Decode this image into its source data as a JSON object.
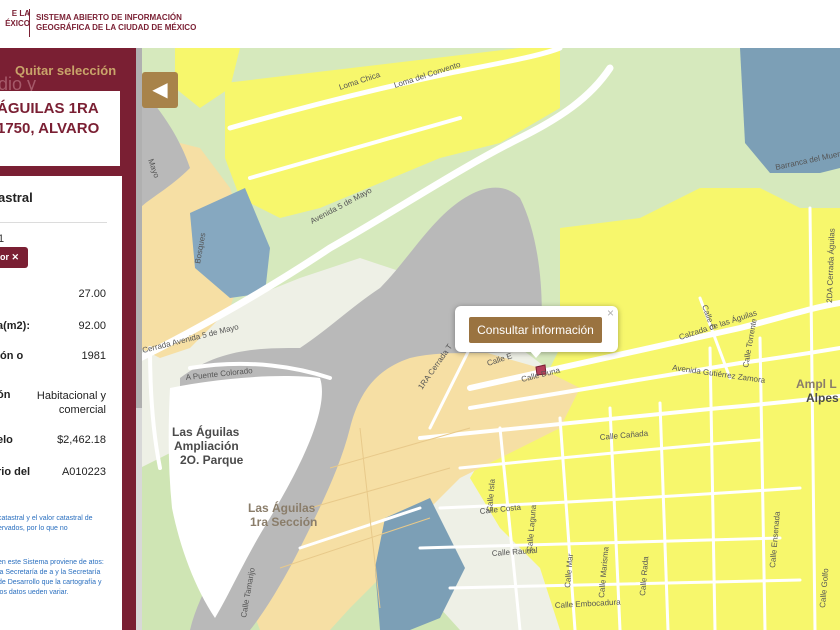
{
  "header": {
    "logo_left_line1": "E LA",
    "logo_left_line2": "ÉXICO",
    "logo_right_line1": "SISTEMA ABIERTO DE INFORMACIÓN",
    "logo_right_line2": "GEOGRÁFICA DE LA CIUDAD DE MÉXICO"
  },
  "panel": {
    "quitar_label": "Quitar selección",
    "bg_text": "dio y",
    "address_line1": "ÁGUILAS 1RA",
    "address_line2": "1750, ALVARO",
    "info": {
      "title": "astral",
      "small_value": "1",
      "chip_label": "or ✕",
      "rows": [
        {
          "label": ":",
          "value": "27.00"
        },
        {
          "label": "a(m2):",
          "value": "92.00"
        },
        {
          "label": "ión o",
          "value": "1981"
        },
        {
          "label": "ón",
          "value": "Habitacional y comercial"
        },
        {
          "label": "elo",
          "value": "$2,462.18"
        },
        {
          "label": "rio del",
          "value": "A010223"
        }
      ],
      "note1": "catastral y el valor catastral de ervados, por lo que no",
      "note2": "en este Sistema proviene de atos: la Secretaría de a y la Secretaría de Desarrollo que la cartografía y los datos ueden variar."
    }
  },
  "controls": {
    "collapse_icon": "◀"
  },
  "popup": {
    "button_label": "Consultar información",
    "close_label": "×"
  },
  "map": {
    "streets": [
      "Loma Chica",
      "Loma del Convento",
      "Avenida 5 de Mayo",
      "Mayo",
      "Bosques",
      "Calzada de las Águilas",
      "Avenida Gutiérrez Zamora",
      "Calle Torrente",
      "2DA Cerrada Águilas",
      "Barranca del Muerto",
      "A Puente Colorado",
      "1RA Cerrada T",
      "Calle E",
      "Calle Duna",
      "Calle Cañada",
      "Calle Isla",
      "Calle Costa",
      "Calle Laguna",
      "Calle Raudal",
      "Calle Mar",
      "Calle Marisma",
      "Calle Rada",
      "Calle Embocadura",
      "Calle Tamarijo",
      "Calle Ensenada",
      "Calle Golfo",
      "Cerrada Avenida 5 de Mayo",
      "Calle C"
    ],
    "neighborhoods": {
      "aguilas_ampliacion": [
        "Las Águilas",
        "Ampliación",
        "2O. Parque"
      ],
      "aguilas_1ra": [
        "Las Águilas",
        "1ra Sección"
      ],
      "alpes": [
        "Ampl L",
        "Alpes"
      ]
    }
  },
  "colors": {
    "panel": "#7a1f33",
    "accent_gold": "#a8834a",
    "residential_yellow": "#f7f76c",
    "residential_beige": "#f6dfa4",
    "greenery": "#cfe5b4",
    "barranca_grey": "#b9b9b9",
    "water_blue": "#7c9fb6"
  }
}
